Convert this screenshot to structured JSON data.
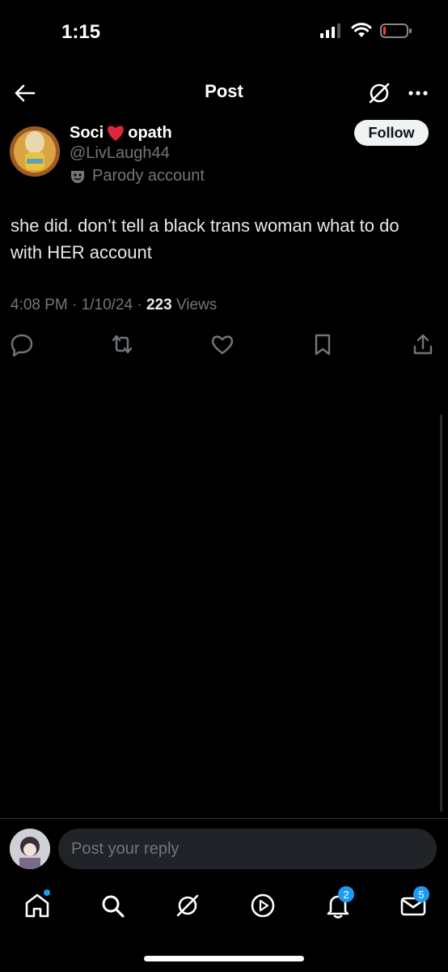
{
  "status_bar": {
    "time": "1:15"
  },
  "nav": {
    "title": "Post"
  },
  "post": {
    "name_part1": "Soci",
    "name_part2": "opath",
    "handle": "@LivLaugh44",
    "parody_label": "Parody account",
    "follow_label": "Follow",
    "text": "she did. don’t tell a black trans woman what to do with HER account",
    "time": "4:08 PM",
    "date": "1/10/24",
    "views_count": "223",
    "views_label": "Views"
  },
  "reply": {
    "placeholder": "Post your reply"
  },
  "tabbar": {
    "notifications_badge": "2",
    "messages_badge": "5"
  },
  "colors": {
    "accent": "#1d9bf0",
    "muted": "#71767b",
    "background": "#000000"
  }
}
